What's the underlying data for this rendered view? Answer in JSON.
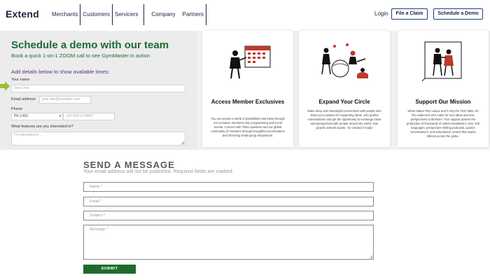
{
  "header": {
    "logo": "Extend",
    "nav": [
      "Merchants",
      "Customers",
      "Servicers",
      "Company",
      "Partners"
    ],
    "login": "Login",
    "file_claim": "File a Claim",
    "schedule_demo": "Schedule a Demo"
  },
  "demo": {
    "title": "Schedule a demo with our team",
    "subtitle": "Book a quick 1-on-1 ZOOM call to see GymMaster in action",
    "add_details": "Add details below to show available times:",
    "name_label": "Your name",
    "name_placeholder": "Jane Doe",
    "email_label": "Email address",
    "email_placeholder": "jane.doe@example.com",
    "phone_label": "Phone",
    "country_code": "PK (+92)",
    "phone_placeholder": "+92-300-1234567",
    "features_label": "What features are you interested in?",
    "features_placeholder": "I'm interested in..."
  },
  "cards": [
    {
      "title": "Access Member Exclusives",
      "text": "You can access a world of possibilities and ideas through our exclusive members-only programming and social events. Connect with TEDx speakers and our global community of members through thoughtful conversations and informing small-group discussions."
    },
    {
      "title": "Expand Your Circle",
      "text": "Make deep and meaningful connections with people who share your passion for supporting ideas. Join guided conversations and get the opportunity to exchange ideas and perspectives with people around the world. Your growth network awaits - be created if ready!"
    },
    {
      "title": "Support Our Mission",
      "text": "What makes TED unique aren't only the TED Talks, it's the audiences who make for new ideas and new perspectives to blossom. Your support powers the production of thousands of videos translated in over 100 languages, perspective-shifting podcasts, quinine conversations, and educational content that inspire billions across the globe."
    }
  ],
  "message": {
    "title": "SEND A MESSAGE",
    "subtitle": "Your email address will not be published. Required fields are marked.",
    "name_placeholder": "Name *",
    "email_placeholder": "Email *",
    "subject_placeholder": "Subject *",
    "message_placeholder": "Message *",
    "submit": "SUBMIT"
  },
  "colors": {
    "brand_navy": "#1b2340",
    "demo_green": "#1d6b33",
    "accent_purple": "#5b2d8e",
    "arrow_green": "#9bbf2f",
    "submit_green": "#1e6b2a",
    "illustration_red": "#c0392b"
  }
}
